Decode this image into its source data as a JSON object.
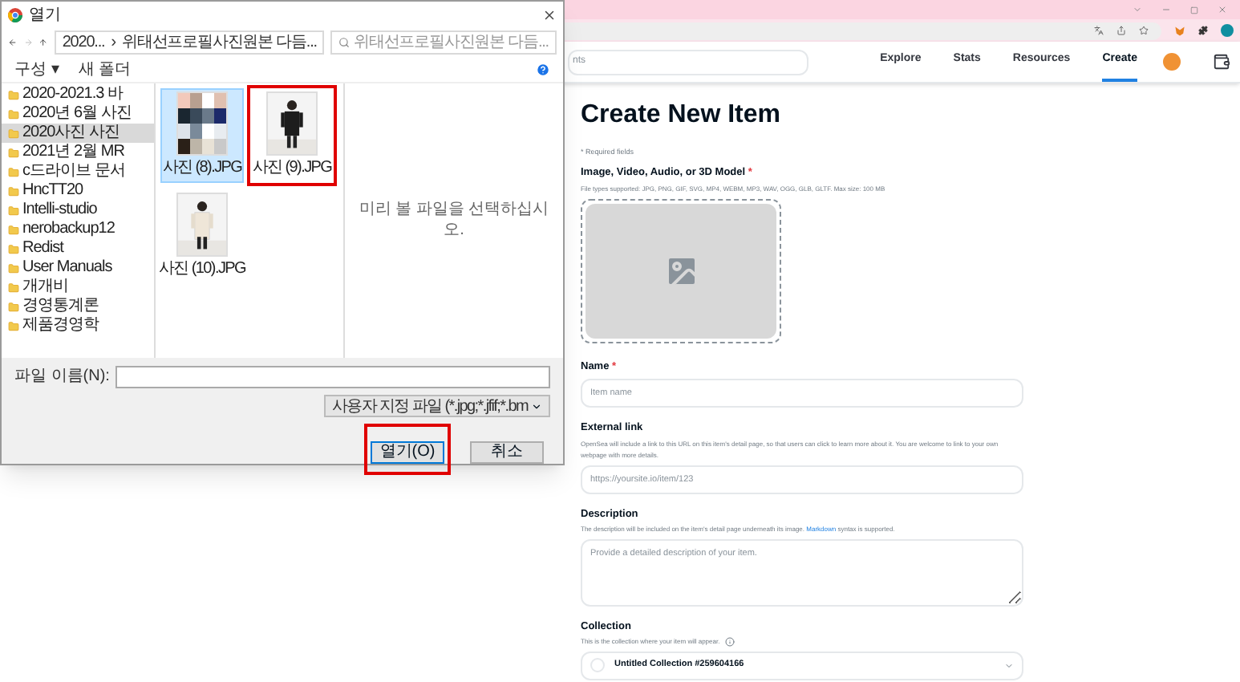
{
  "dialog": {
    "title": "열기",
    "path": [
      "2020...",
      "›",
      "위태선프로필사진원본 다듬..."
    ],
    "search": {
      "placeholder": "위태선프로필사진원본 다듬..."
    },
    "toolbar": [
      "구성 ▾",
      "새 폴더"
    ],
    "folders": [
      {
        "label": "2020-2021.3 바",
        "selected": false
      },
      {
        "label": "2020년 6월 사진",
        "selected": false
      },
      {
        "label": "2020사진 사진",
        "selected": true
      },
      {
        "label": "2021년 2월 MR",
        "selected": false
      },
      {
        "label": "c드라이브 문서",
        "selected": false
      },
      {
        "label": "HncTT20",
        "selected": false
      },
      {
        "label": "Intelli-studio",
        "selected": false
      },
      {
        "label": "nerobackup12",
        "selected": false
      },
      {
        "label": "Redist",
        "selected": false
      },
      {
        "label": "User Manuals",
        "selected": false
      },
      {
        "label": "개개비",
        "selected": false
      },
      {
        "label": "경영통계론",
        "selected": false
      },
      {
        "label": "제품경영학",
        "selected": false
      }
    ],
    "files": [
      {
        "label": "사진 (8).JPG",
        "selected": true,
        "highlighted": false
      },
      {
        "label": "사진 (9).JPG",
        "selected": false,
        "highlighted": true
      },
      {
        "label": "사진 (10).JPG",
        "selected": false,
        "highlighted": false
      }
    ],
    "preview": "미리 볼 파일을 선택하십시오.",
    "filename_label": "파일 이름(N):",
    "filter": "사용자 지정 파일 (*.jpg;*.jfif;*.bm",
    "buttons": [
      {
        "label": "열기(O)",
        "highlighted": true
      },
      {
        "label": "취소",
        "highlighted": false
      }
    ]
  },
  "nav": [
    {
      "label": "Explore",
      "selected": false
    },
    {
      "label": "Stats",
      "selected": false
    },
    {
      "label": "Resources",
      "selected": false
    },
    {
      "label": "Create",
      "selected": true
    }
  ],
  "search_fragment": "nts",
  "form": {
    "title": "Create New Item",
    "required_note": "* Required fields",
    "media": {
      "label": "Image, Video, Audio, or 3D Model",
      "required_mark": "*",
      "help": "File types supported: JPG, PNG, GIF, SVG, MP4, WEBM, MP3, WAV, OGG, GLB, GLTF. Max size: 100 MB"
    },
    "name": {
      "label": "Name",
      "required_mark": "*",
      "placeholder": "Item name"
    },
    "external_link": {
      "label": "External link",
      "help": "OpenSea will include a link to this URL on this item's detail page, so that users can click to learn more about it. You are welcome to link to your own webpage with more details.",
      "placeholder": "https://yoursite.io/item/123"
    },
    "description": {
      "label": "Description",
      "help_before": "The description will be included on the item's detail page underneath its image.",
      "help_link": "Markdown",
      "help_after": "syntax is supported.",
      "placeholder": "Provide a detailed description of your item."
    },
    "collection": {
      "label": "Collection",
      "help": "This is the collection where your item will appear.",
      "value": "Untitled Collection #259604166"
    }
  }
}
